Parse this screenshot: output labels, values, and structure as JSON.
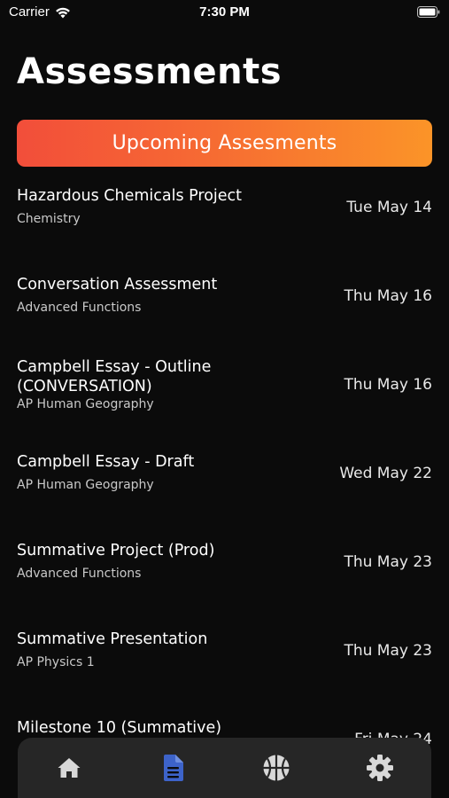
{
  "status_bar": {
    "carrier": "Carrier",
    "time": "7:30 PM"
  },
  "page": {
    "title": "Assessments",
    "banner_label": "Upcoming Assesments"
  },
  "assessments": [
    {
      "title": "Hazardous Chemicals Project",
      "subject": "Chemistry",
      "date": "Tue May 14"
    },
    {
      "title": "Conversation Assessment",
      "subject": "Advanced Functions",
      "date": "Thu May 16"
    },
    {
      "title": "Campbell Essay - Outline (CONVERSATION)",
      "subject": "AP Human Geography",
      "date": "Thu May 16"
    },
    {
      "title": "Campbell Essay - Draft",
      "subject": "AP Human Geography",
      "date": "Wed May 22"
    },
    {
      "title": "Summative Project (Prod)",
      "subject": "Advanced Functions",
      "date": "Thu May 23"
    },
    {
      "title": "Summative Presentation",
      "subject": "AP Physics 1",
      "date": "Thu May 23"
    },
    {
      "title": "Milestone 10 (Summative)",
      "subject": "",
      "date": "Fri May 24"
    }
  ],
  "tab_bar": {
    "tabs": [
      {
        "icon": "home-icon",
        "active": false
      },
      {
        "icon": "document-icon",
        "active": true
      },
      {
        "icon": "basketball-icon",
        "active": false
      },
      {
        "icon": "gear-icon",
        "active": false
      }
    ],
    "active_color": "#3d63c9",
    "inactive_color": "#d8d8d8"
  },
  "colors": {
    "background": "#0b0b0b",
    "banner_gradient_start": "#f24e3a",
    "banner_gradient_end": "#fb9428"
  }
}
